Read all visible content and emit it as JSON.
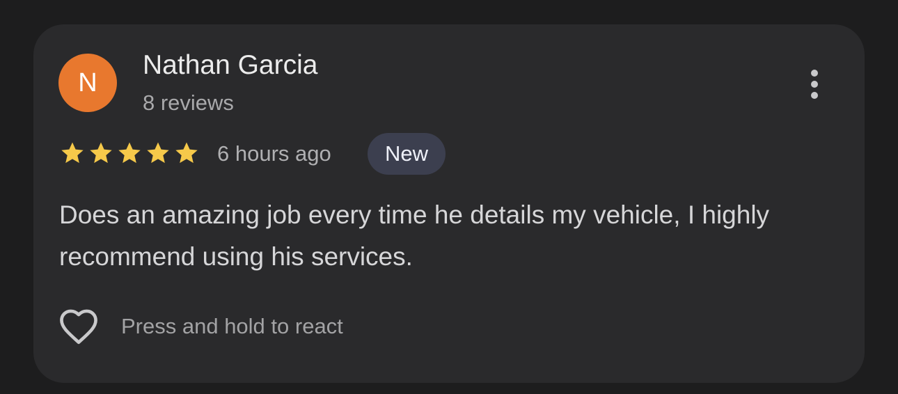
{
  "review": {
    "author_name": "Nathan Garcia",
    "author_initial": "N",
    "author_review_count": "8 reviews",
    "rating": 5,
    "rating_max": 5,
    "time_ago": "6 hours ago",
    "badge": "New",
    "text": "Does an amazing job every time he details my vehicle, I highly recommend using his services.",
    "react_prompt": "Press and hold to react"
  },
  "icons": {
    "more": "more-vert-icon",
    "star": "star-icon",
    "heart": "heart-outline-icon"
  },
  "colors": {
    "avatar_bg": "#e8782e",
    "star": "#f6c94a",
    "badge_bg": "#3c3f4f",
    "card_bg": "#2a2a2c",
    "page_bg": "#1d1d1e"
  }
}
